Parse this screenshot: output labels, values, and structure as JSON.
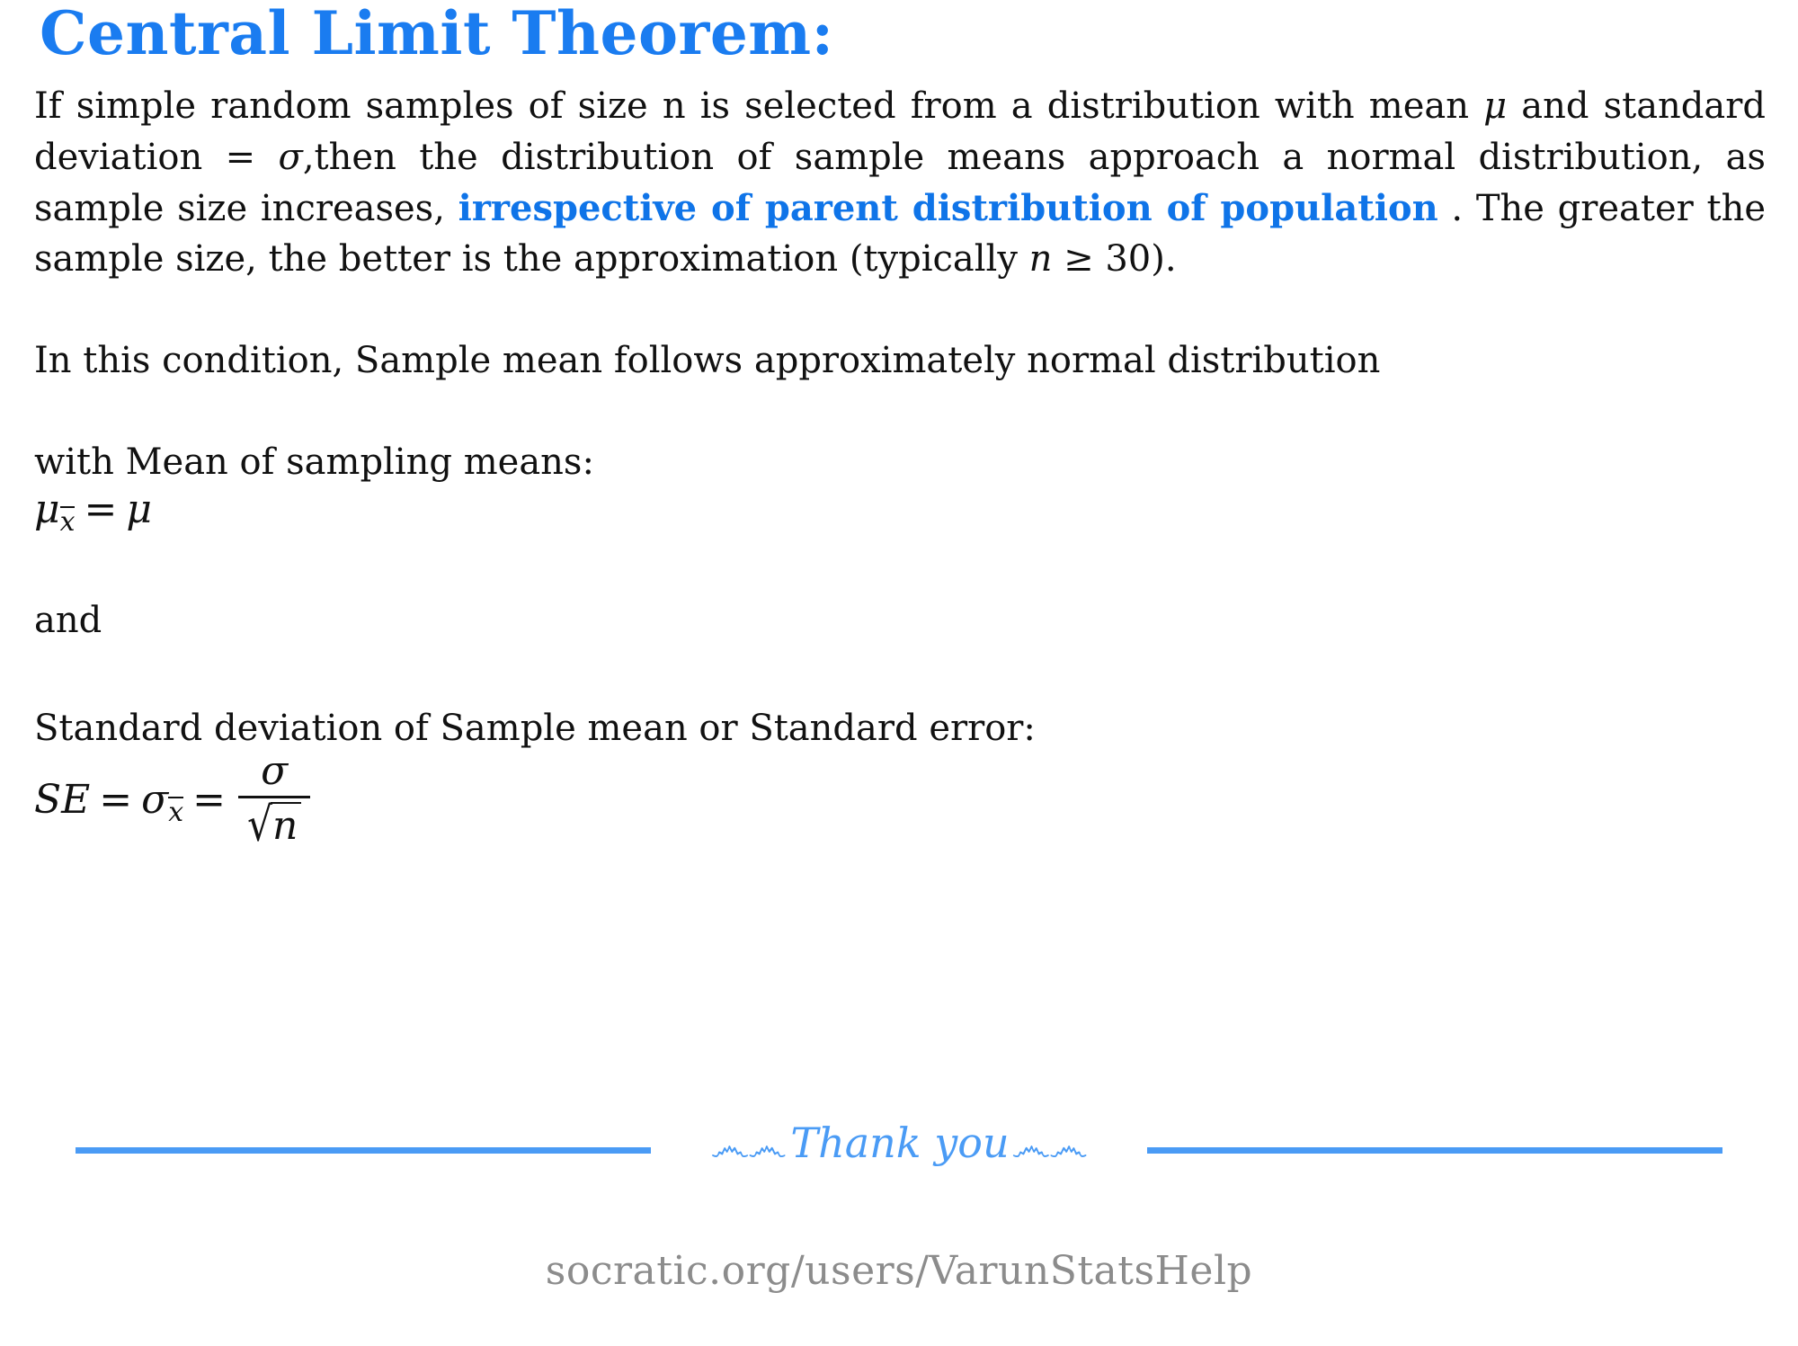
{
  "document": {
    "title": "Central Limit Theorem:",
    "title_color": "#1a7cf0",
    "accent_color": "#0f74e8",
    "rule_color": "#4a9bf5",
    "footer_color": "#8c8c8c",
    "background": "#ffffff"
  },
  "paragraph1": {
    "seg1": "If simple random samples of size n is selected from a distribution with mean ",
    "mu1": "μ",
    "seg2": " and standard deviation = ",
    "sigma1": "σ",
    "seg3": ",then the distribution of sample means approach a normal distribution, as sample size increases, ",
    "emphasis": "irrespective of parent distribution of population",
    "seg4": " . The greater the sample size, the better is the approximation (typically ",
    "n_var": "n",
    "geq": " ≥ ",
    "n_value": "30",
    "seg5": ")."
  },
  "paragraph2": {
    "text": "In this condition, Sample mean follows approximately normal distribution"
  },
  "mean_block": {
    "label": "with Mean of sampling means:",
    "formula": {
      "mu_lhs": "μ",
      "sub_xbar": "x",
      "equals": "=",
      "mu_rhs": "μ"
    }
  },
  "conjunction": {
    "text": "and"
  },
  "se_block": {
    "label": "Standard deviation of Sample mean or Standard error:",
    "formula": {
      "se": "SE",
      "equals1": "=",
      "sigma_sub": "σ",
      "sub_xbar": "x",
      "equals2": "=",
      "numerator": "σ",
      "radical_sign": "√",
      "radicand": "n"
    }
  },
  "thanks": {
    "swirl_left": "෴෴",
    "text": "Thank you",
    "swirl_right": "෴෴"
  },
  "footer": {
    "url": "socratic.org/users/VarunStatsHelp"
  }
}
